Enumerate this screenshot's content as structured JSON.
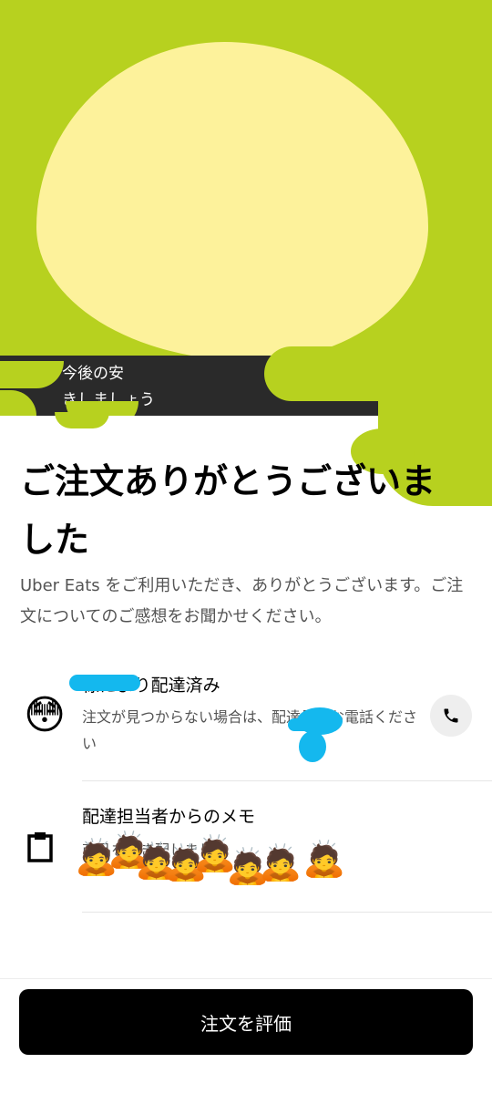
{
  "hero": {
    "caption_line1": "今後の安",
    "caption_line2": "きしましょう",
    "background_color": "#b7d11f",
    "blob_color": "#fdf29b"
  },
  "main": {
    "title": "ご注文ありがとうございました",
    "subtitle": "Uber Eats をご利用いただき、ありがとうございます。ご注文についてのご感想をお聞かせください。"
  },
  "delivery_row": {
    "emoji": "😳",
    "title": "様により配達済み",
    "description": "注文が見つからない場合は、配達員にお電話ください",
    "call_icon": "phone-icon"
  },
  "memo_row": {
    "icon": "clipboard-icon",
    "title": "配達担当者からのメモ",
    "text": "商品を置き配しました",
    "emoji": "🙇"
  },
  "footer": {
    "rate_button_label": "注文を評価"
  }
}
